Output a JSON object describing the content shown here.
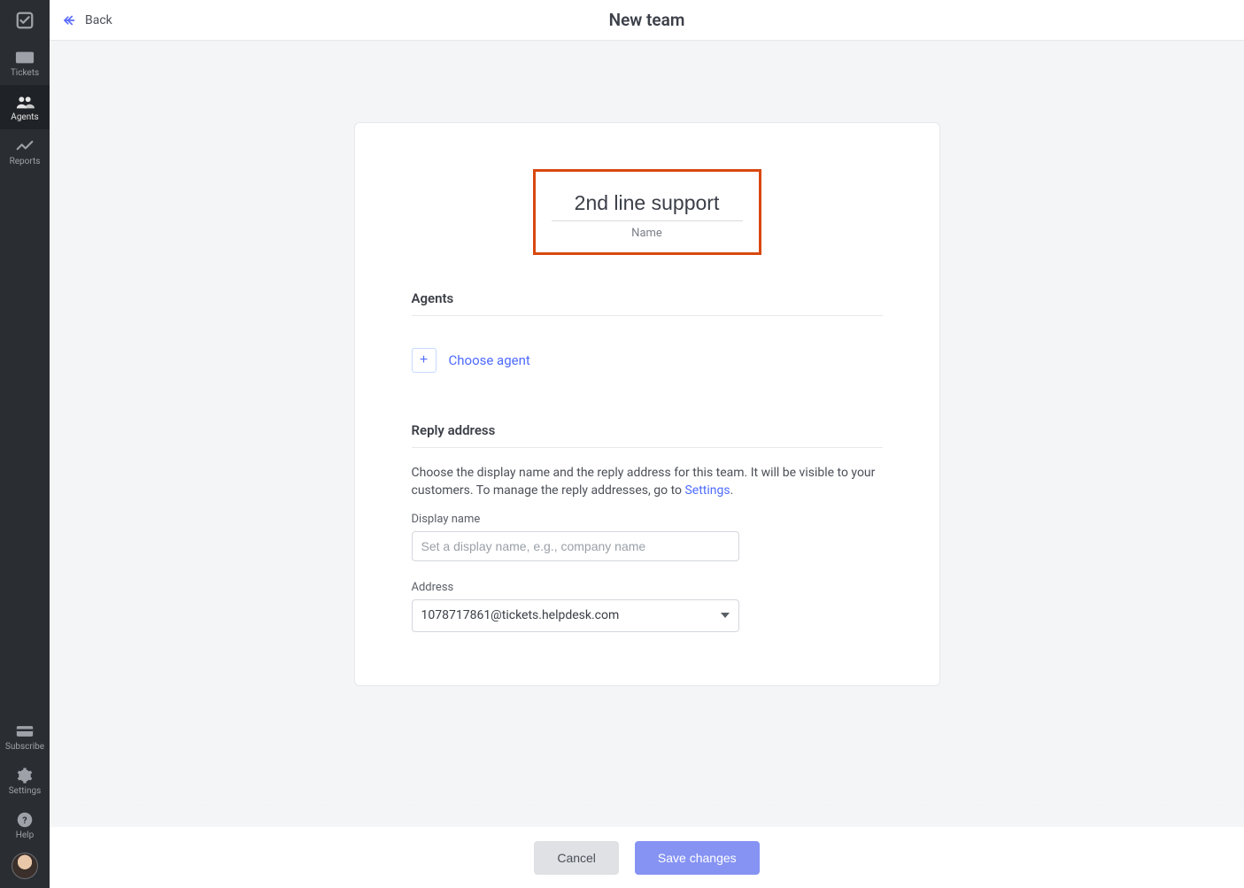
{
  "sidebar": {
    "items": [
      {
        "label": "Tickets"
      },
      {
        "label": "Agents"
      },
      {
        "label": "Reports"
      }
    ],
    "bottom": [
      {
        "label": "Subscribe"
      },
      {
        "label": "Settings"
      },
      {
        "label": "Help"
      }
    ],
    "active_index": 1
  },
  "header": {
    "back_label": "Back",
    "title": "New team"
  },
  "team": {
    "name_value": "2nd line support",
    "name_caption": "Name"
  },
  "agents_section": {
    "title": "Agents",
    "choose_label": "Choose agent"
  },
  "reply_section": {
    "title": "Reply address",
    "description_prefix": "Choose the display name and the reply address for this team. It will be visible to your customers. To manage the reply addresses, go to ",
    "settings_link": "Settings",
    "description_suffix": ".",
    "display_name_label": "Display name",
    "display_name_placeholder": "Set a display name, e.g., company name",
    "display_name_value": "",
    "address_label": "Address",
    "address_value": "1078717861@tickets.helpdesk.com"
  },
  "footer": {
    "cancel": "Cancel",
    "save": "Save changes"
  }
}
